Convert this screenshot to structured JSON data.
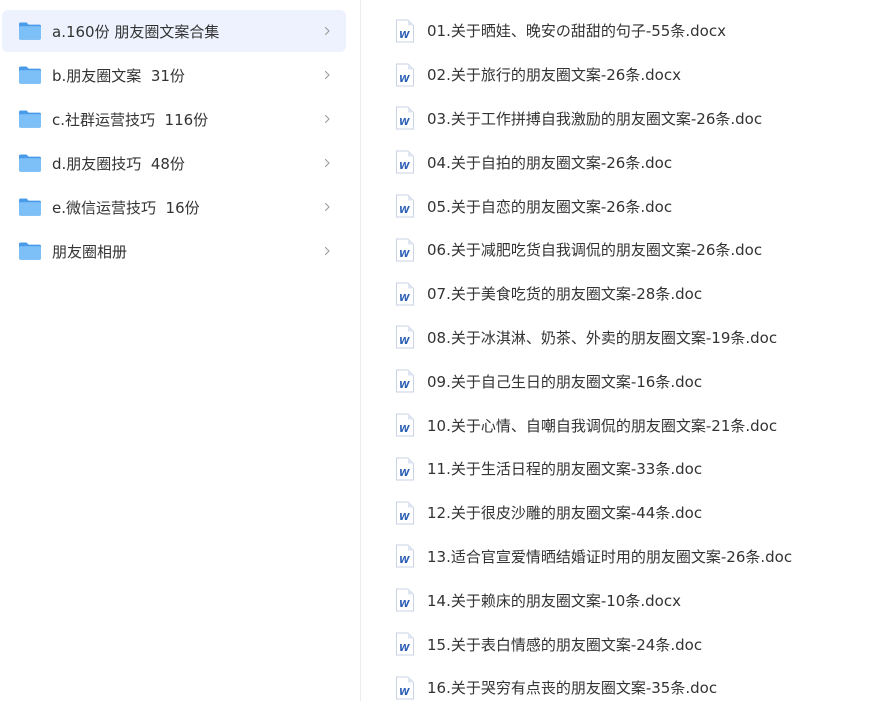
{
  "colors": {
    "selected_bg": "#edf2fe",
    "folder_blue": "#5cabf0",
    "word_blue": "#2b5fb5",
    "text": "#333333"
  },
  "folders": [
    {
      "label": "a.160份 朋友圈文案合集",
      "selected": true,
      "icon": "folder-icon"
    },
    {
      "label": "b.朋友圈文案  31份",
      "selected": false,
      "icon": "folder-icon"
    },
    {
      "label": "c.社群运营技巧  116份",
      "selected": false,
      "icon": "folder-icon"
    },
    {
      "label": "d.朋友圈技巧  48份",
      "selected": false,
      "icon": "folder-icon"
    },
    {
      "label": "e.微信运营技巧  16份",
      "selected": false,
      "icon": "folder-icon"
    },
    {
      "label": "朋友圈相册",
      "selected": false,
      "icon": "folder-icon"
    }
  ],
  "files": [
    {
      "name": "01.关于晒娃、晚安の甜甜的句子-55条.docx",
      "icon": "word-doc-icon"
    },
    {
      "name": "02.关于旅行的朋友圈文案-26条.docx",
      "icon": "word-doc-icon"
    },
    {
      "name": "03.关于工作拼搏自我激励的朋友圈文案-26条.doc",
      "icon": "word-doc-icon"
    },
    {
      "name": "04.关于自拍的朋友圈文案-26条.doc",
      "icon": "word-doc-icon"
    },
    {
      "name": "05.关于自恋的朋友圈文案-26条.doc",
      "icon": "word-doc-icon"
    },
    {
      "name": "06.关于减肥吃货自我调侃的朋友圈文案-26条.doc",
      "icon": "word-doc-icon"
    },
    {
      "name": "07.关于美食吃货的朋友圈文案-28条.doc",
      "icon": "word-doc-icon"
    },
    {
      "name": "08.关于冰淇淋、奶茶、外卖的朋友圈文案-19条.doc",
      "icon": "word-doc-icon"
    },
    {
      "name": "09.关于自己生日的朋友圈文案-16条.doc",
      "icon": "word-doc-icon"
    },
    {
      "name": "10.关于心情、自嘲自我调侃的朋友圈文案-21条.doc",
      "icon": "word-doc-icon"
    },
    {
      "name": "11.关于生活日程的朋友圈文案-33条.doc",
      "icon": "word-doc-icon"
    },
    {
      "name": "12.关于很皮沙雕的朋友圈文案-44条.doc",
      "icon": "word-doc-icon"
    },
    {
      "name": "13.适合官宣爱情晒结婚证时用的朋友圈文案-26条.doc",
      "icon": "word-doc-icon"
    },
    {
      "name": "14.关于赖床的朋友圈文案-10条.docx",
      "icon": "word-doc-icon"
    },
    {
      "name": "15.关于表白情感的朋友圈文案-24条.doc",
      "icon": "word-doc-icon"
    },
    {
      "name": "16.关于哭穷有点丧的朋友圈文案-35条.doc",
      "icon": "word-doc-icon"
    }
  ]
}
